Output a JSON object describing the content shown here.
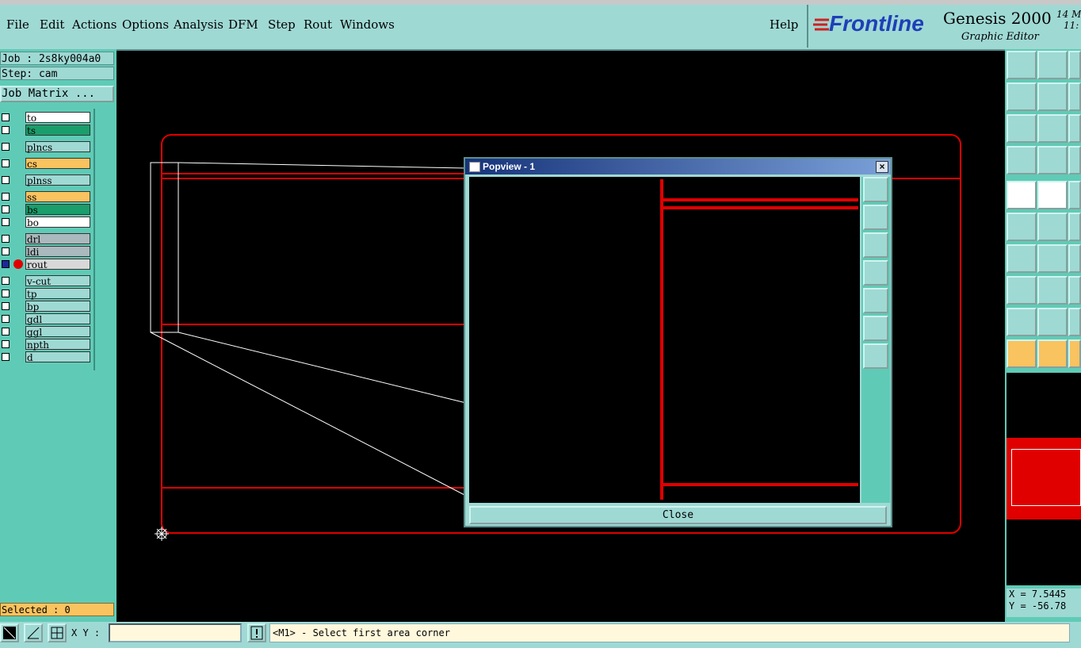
{
  "menu": {
    "items": [
      "File",
      "Edit",
      "Actions",
      "Options",
      "Analysis",
      "DFM",
      "Step",
      "Rout",
      "Windows"
    ],
    "help": "Help"
  },
  "brand": {
    "logo": "Frontline",
    "product": "Genesis 2000",
    "subtitle": "Graphic Editor",
    "clock_date": "14 M",
    "clock_time": "11:"
  },
  "left": {
    "job": "Job : 2s8ky004a0",
    "step": "Step: cam",
    "job_matrix": "Job Matrix ...",
    "selected": "Selected : 0",
    "layers": [
      {
        "name": "to",
        "color": "#ffffff"
      },
      {
        "name": "ts",
        "color": "#1a9e6b"
      },
      {
        "name": "plncs",
        "color": "#9fd9d4"
      },
      {
        "name": "cs",
        "color": "#f9c35f"
      },
      {
        "name": "plnss",
        "color": "#9fd9d4"
      },
      {
        "name": "ss",
        "color": "#f9c35f"
      },
      {
        "name": "bs",
        "color": "#1a9e6b"
      },
      {
        "name": "bo",
        "color": "#ffffff"
      },
      {
        "name": "drl",
        "color": "#a9b9bd"
      },
      {
        "name": "ldi",
        "color": "#a9b9bd"
      },
      {
        "name": "rout",
        "color": "#d8d8d8",
        "active": true
      },
      {
        "name": "v-cut",
        "color": "#9fd9d4"
      },
      {
        "name": "tp",
        "color": "#9fd9d4"
      },
      {
        "name": "bp",
        "color": "#9fd9d4"
      },
      {
        "name": "gdl",
        "color": "#9fd9d4"
      },
      {
        "name": "ggl",
        "color": "#9fd9d4"
      },
      {
        "name": "npth",
        "color": "#9fd9d4"
      },
      {
        "name": "d",
        "color": "#9fd9d4"
      }
    ]
  },
  "popview": {
    "title": "Popview - 1",
    "close_label": "Close"
  },
  "bottom": {
    "xy_label": "X Y :",
    "xy_value": "",
    "prompt": "<M1> - Select first area corner"
  },
  "coords": {
    "x": "X = 7.5445",
    "y": "Y = -56.78"
  },
  "colors": {
    "profile_red": "#e00000",
    "panel_teal": "#5fcbb6",
    "panel_light": "#9fd9d4",
    "highlight_orange": "#f9c35f"
  }
}
